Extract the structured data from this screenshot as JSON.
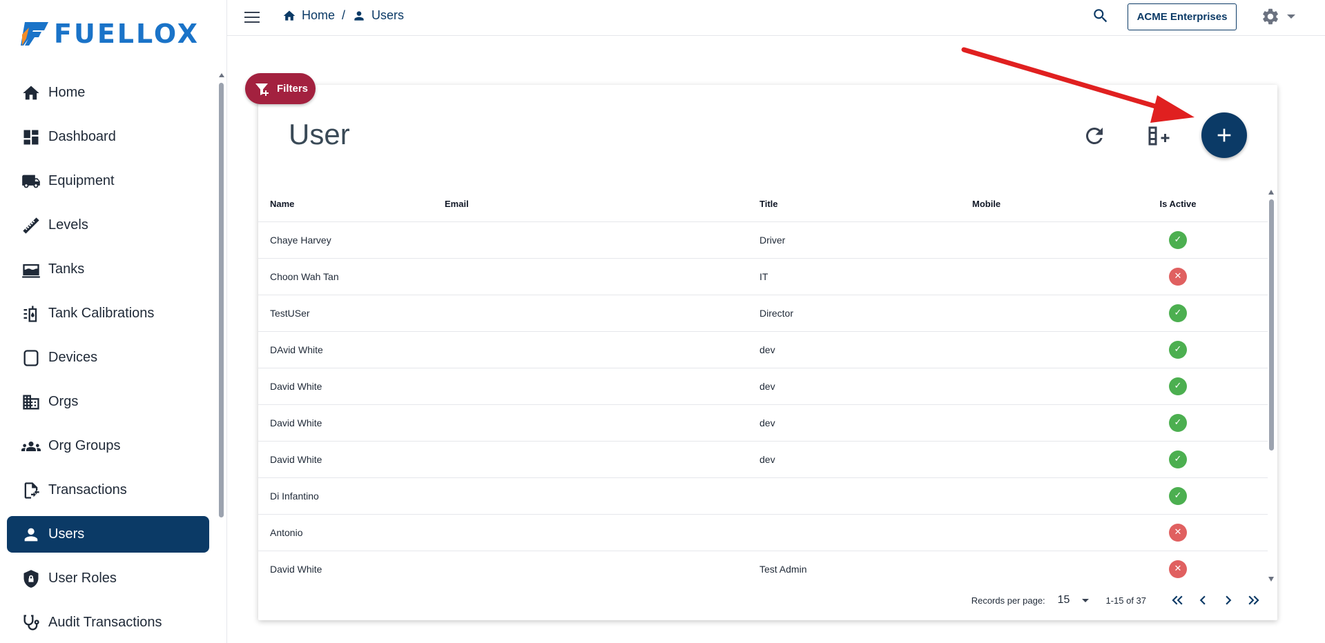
{
  "brand": {
    "name": "FUELLOX",
    "logo_colors": {
      "blue": "#1a73c8",
      "orange": "#f28c28"
    }
  },
  "sidebar": {
    "items": [
      {
        "label": "Home",
        "icon": "home-icon"
      },
      {
        "label": "Dashboard",
        "icon": "dashboard-icon"
      },
      {
        "label": "Equipment",
        "icon": "truck-icon"
      },
      {
        "label": "Levels",
        "icon": "ruler-icon"
      },
      {
        "label": "Tanks",
        "icon": "tank-icon"
      },
      {
        "label": "Tank Calibrations",
        "icon": "calibration-icon"
      },
      {
        "label": "Devices",
        "icon": "device-icon"
      },
      {
        "label": "Orgs",
        "icon": "building-icon"
      },
      {
        "label": "Org Groups",
        "icon": "groups-icon"
      },
      {
        "label": "Transactions",
        "icon": "transactions-icon"
      },
      {
        "label": "Users",
        "icon": "user-icon",
        "active": true
      },
      {
        "label": "User Roles",
        "icon": "shield-lock-icon"
      },
      {
        "label": "Audit Transactions",
        "icon": "stethoscope-icon"
      }
    ]
  },
  "topbar": {
    "breadcrumbs": [
      {
        "label": "Home",
        "icon": "home-icon"
      },
      {
        "label": "Users",
        "icon": "user-icon"
      }
    ],
    "separator": "/",
    "org_label": "ACME Enterprises"
  },
  "filters": {
    "label": "Filters"
  },
  "card": {
    "title": "User",
    "columns": [
      "Name",
      "Email",
      "Title",
      "Mobile",
      "Is Active"
    ],
    "rows": [
      {
        "name": "Chaye Harvey",
        "email": "",
        "title": "Driver",
        "mobile": "",
        "active": true
      },
      {
        "name": "Choon Wah Tan",
        "email": "",
        "title": "IT",
        "mobile": "",
        "active": false
      },
      {
        "name": "TestUSer",
        "email": "",
        "title": "Director",
        "mobile": "",
        "active": true
      },
      {
        "name": "DAvid White",
        "email": "",
        "title": "dev",
        "mobile": "",
        "active": true
      },
      {
        "name": "David White",
        "email": "",
        "title": "dev",
        "mobile": "",
        "active": true
      },
      {
        "name": "David White",
        "email": "",
        "title": "dev",
        "mobile": "",
        "active": true
      },
      {
        "name": "David White",
        "email": "",
        "title": "dev",
        "mobile": "",
        "active": true
      },
      {
        "name": "Di Infantino",
        "email": "",
        "title": "",
        "mobile": "",
        "active": true
      },
      {
        "name": "Antonio",
        "email": "",
        "title": "",
        "mobile": "",
        "active": false
      },
      {
        "name": "David White",
        "email": "",
        "title": "Test Admin",
        "mobile": "",
        "active": false
      }
    ],
    "status_colors": {
      "active": "#4caf50",
      "inactive": "#e06060"
    }
  },
  "pagination": {
    "records_per_page_label": "Records per page:",
    "records_per_page": "15",
    "range": "1-15 of 37"
  },
  "colors": {
    "primary": "#0b3a66",
    "filters": "#a3213f",
    "annotation_arrow": "#e02020"
  }
}
